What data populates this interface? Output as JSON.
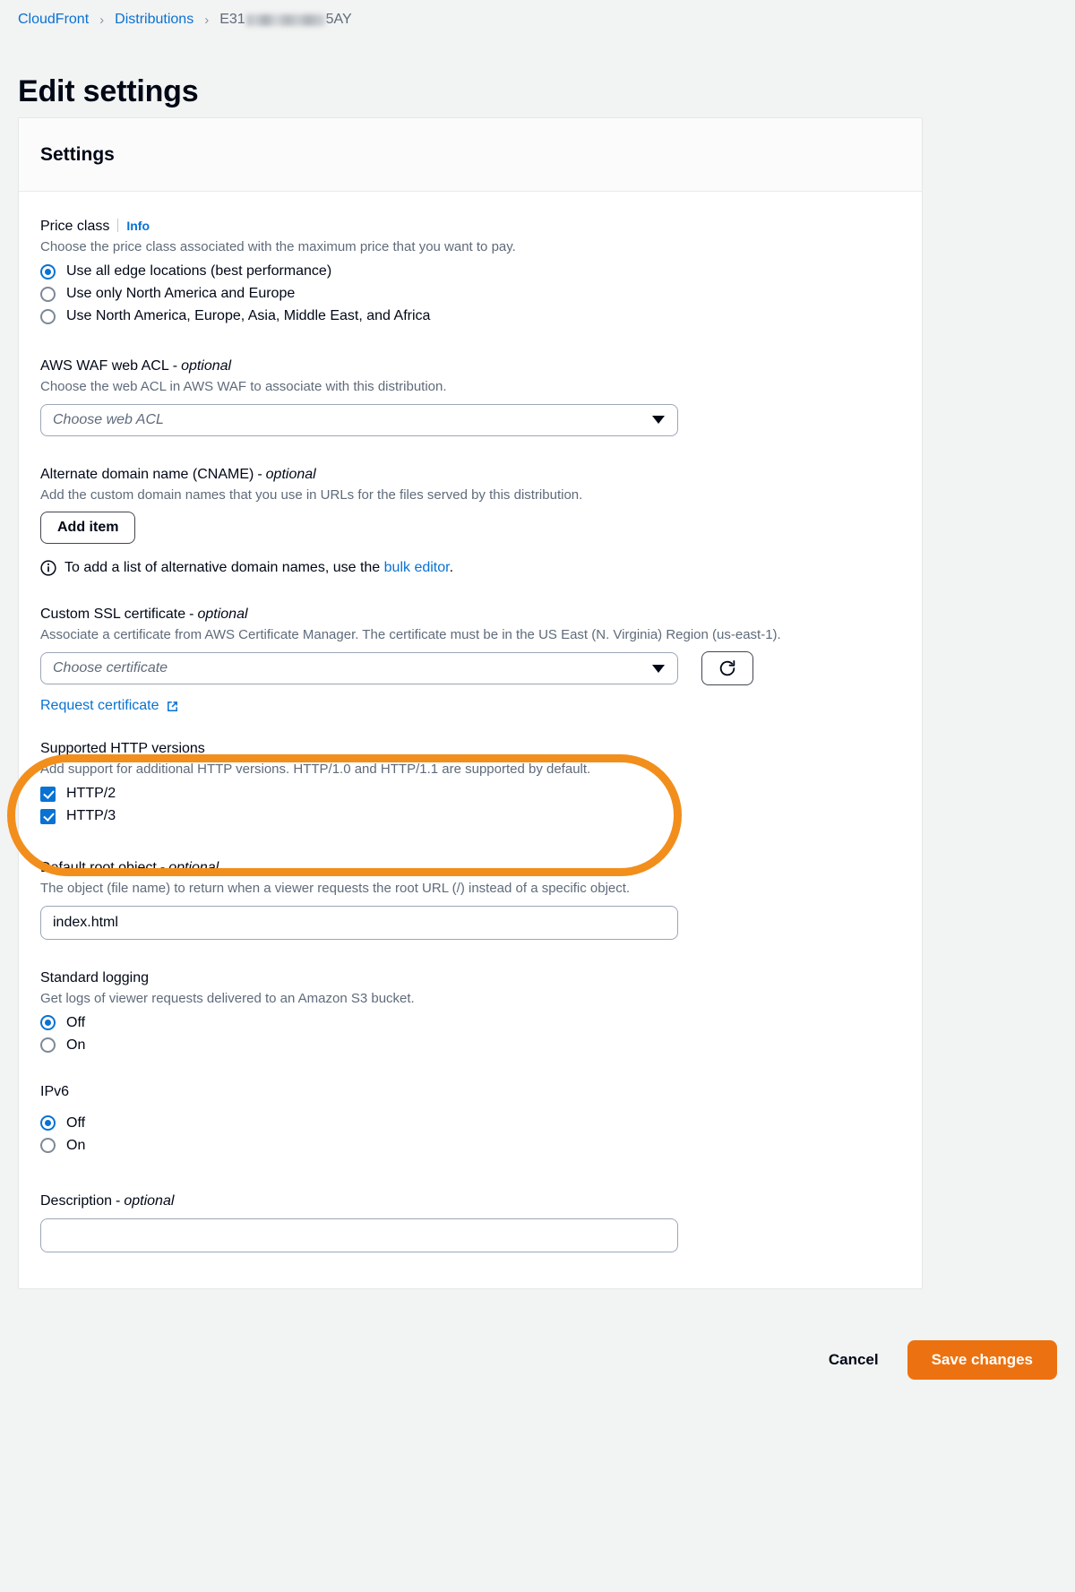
{
  "breadcrumb": {
    "items": [
      {
        "label": "CloudFront",
        "type": "link"
      },
      {
        "label": "Distributions",
        "type": "link"
      },
      {
        "label_prefix": "E31",
        "label_suffix": "5AY",
        "type": "current"
      }
    ],
    "separator": "›"
  },
  "page": {
    "title": "Edit settings"
  },
  "panel": {
    "header": "Settings"
  },
  "price_class": {
    "label": "Price class",
    "info_label": "Info",
    "description": "Choose the price class associated with the maximum price that you want to pay.",
    "options": [
      {
        "label": "Use all edge locations (best performance)",
        "checked": true
      },
      {
        "label": "Use only North America and Europe",
        "checked": false
      },
      {
        "label": "Use North America, Europe, Asia, Middle East, and Africa",
        "checked": false
      }
    ]
  },
  "waf": {
    "label": "AWS WAF web ACL",
    "optional_suffix": "optional",
    "description": "Choose the web ACL in AWS WAF to associate with this distribution.",
    "select_placeholder": "Choose web ACL"
  },
  "cname": {
    "label": "Alternate domain name (CNAME)",
    "optional_suffix": "optional",
    "description": "Add the custom domain names that you use in URLs for the files served by this distribution.",
    "add_item_label": "Add item",
    "note_prefix": "To add a list of alternative domain names, use the ",
    "note_link": "bulk editor",
    "note_suffix": ".",
    "note_icon": "info-circle-icon"
  },
  "ssl": {
    "label": "Custom SSL certificate",
    "optional_suffix": "optional",
    "description": "Associate a certificate from AWS Certificate Manager. The certificate must be in the US East (N. Virginia) Region (us-east-1).",
    "select_placeholder": "Choose certificate",
    "refresh_icon": "refresh-icon",
    "request_link": "Request certificate",
    "request_link_icon": "external-link-icon"
  },
  "http_versions": {
    "label": "Supported HTTP versions",
    "description": "Add support for additional HTTP versions. HTTP/1.0 and HTTP/1.1 are supported by default.",
    "options": [
      {
        "label": "HTTP/2",
        "checked": true
      },
      {
        "label": "HTTP/3",
        "checked": true
      }
    ],
    "highlight_color": "#f28e1c"
  },
  "default_root_object": {
    "label": "Default root object",
    "optional_suffix": "optional",
    "description": "The object (file name) to return when a viewer requests the root URL (/) instead of a specific object.",
    "value": "index.html"
  },
  "standard_logging": {
    "label": "Standard logging",
    "description": "Get logs of viewer requests delivered to an Amazon S3 bucket.",
    "options": [
      {
        "label": "Off",
        "checked": true
      },
      {
        "label": "On",
        "checked": false
      }
    ]
  },
  "ipv6": {
    "label": "IPv6",
    "options": [
      {
        "label": "Off",
        "checked": true
      },
      {
        "label": "On",
        "checked": false
      }
    ]
  },
  "description_field": {
    "label": "Description",
    "optional_suffix": "optional",
    "value": ""
  },
  "footer": {
    "cancel_label": "Cancel",
    "save_label": "Save changes",
    "save_color": "#ec7211"
  }
}
